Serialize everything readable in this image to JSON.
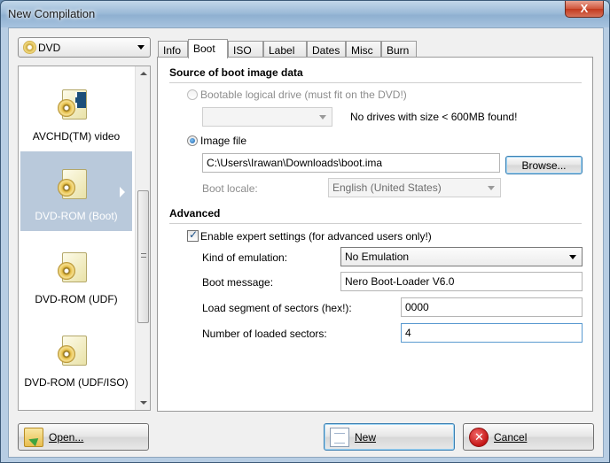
{
  "window": {
    "title": "New Compilation",
    "close_glyph": "X"
  },
  "disc_type": {
    "selected": "DVD"
  },
  "compilation_list": [
    {
      "label": "AVCHD(TM) video",
      "selected": false
    },
    {
      "label": "DVD-ROM (Boot)",
      "selected": true
    },
    {
      "label": "DVD-ROM (UDF)",
      "selected": false
    },
    {
      "label": "DVD-ROM (UDF/ISO)",
      "selected": false
    }
  ],
  "tabs": [
    {
      "label": "Info",
      "active": false
    },
    {
      "label": "Boot",
      "active": true
    },
    {
      "label": "ISO",
      "active": false
    },
    {
      "label": "Label",
      "active": false
    },
    {
      "label": "Dates",
      "active": false
    },
    {
      "label": "Misc",
      "active": false
    },
    {
      "label": "Burn",
      "active": false
    }
  ],
  "boot": {
    "source_heading": "Source of boot image data",
    "logical_drive_label": "Bootable logical drive (must fit on the DVD!)",
    "logical_drive_value": "",
    "no_drives_msg": "No drives with size < 600MB found!",
    "image_file_label": "Image file",
    "image_file_path": "C:\\Users\\Irawan\\Downloads\\boot.ima",
    "browse_label": "Browse...",
    "boot_locale_label": "Boot locale:",
    "boot_locale_value": "English (United States)",
    "advanced_heading": "Advanced",
    "expert_label": "Enable expert settings (for advanced users only!)",
    "expert_checked": true,
    "emulation_label": "Kind of emulation:",
    "emulation_value": "No Emulation",
    "boot_message_label": "Boot message:",
    "boot_message_value": "Nero Boot-Loader V6.0",
    "load_segment_label": "Load segment of sectors (hex!):",
    "load_segment_value": "0000",
    "loaded_sectors_label": "Number of loaded sectors:",
    "loaded_sectors_value": "4"
  },
  "buttons": {
    "open": "Open...",
    "new": "New",
    "cancel": "Cancel"
  }
}
